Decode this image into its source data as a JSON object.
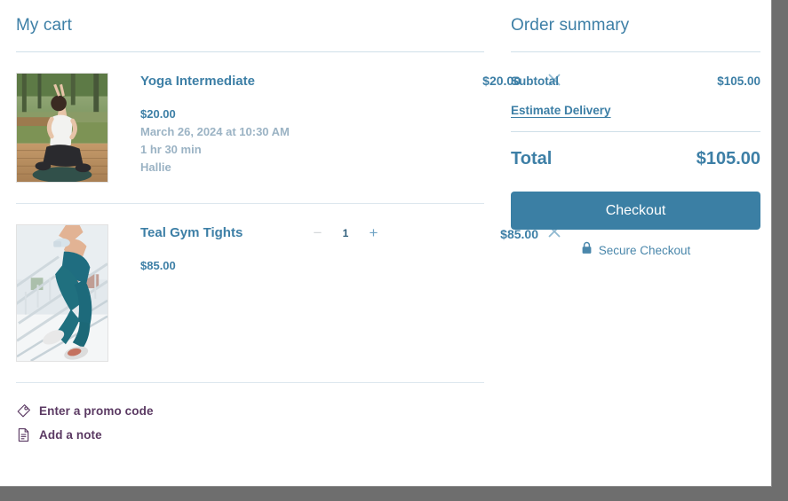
{
  "cart": {
    "title": "My cart",
    "items": [
      {
        "name": "Yoga Intermediate",
        "line_price": "$20.00",
        "unit_price": "$20.00",
        "datetime": "March 26, 2024 at 10:30 AM",
        "duration": "1 hr 30 min",
        "instructor": "Hallie",
        "remove_label": "close-icon",
        "image_alt": "woman doing yoga pose on wooden deck outdoors"
      },
      {
        "name": "Teal Gym Tights",
        "line_price": "$85.00",
        "unit_price": "$85.00",
        "quantity": "1",
        "decrease_label": "−",
        "increase_label": "+",
        "remove_label": "close-icon",
        "image_alt": "runner in teal leggings climbing stadium stairs"
      }
    ],
    "footer": {
      "promo_label": "Enter a promo code",
      "note_label": "Add a note"
    }
  },
  "summary": {
    "title": "Order summary",
    "subtotal_label": "Subtotal",
    "subtotal_value": "$105.00",
    "estimate_delivery_label": "Estimate Delivery",
    "total_label": "Total",
    "total_value": "$105.00",
    "checkout_label": "Checkout",
    "secure_label": "Secure Checkout"
  },
  "theme": {
    "accent": "#3d7fa6",
    "button": "#3b7fa4",
    "muted": "#9bb3c4",
    "link_purple": "#5b3a63",
    "divider": "#cfdfe8",
    "frame": "#6e6e6e"
  }
}
